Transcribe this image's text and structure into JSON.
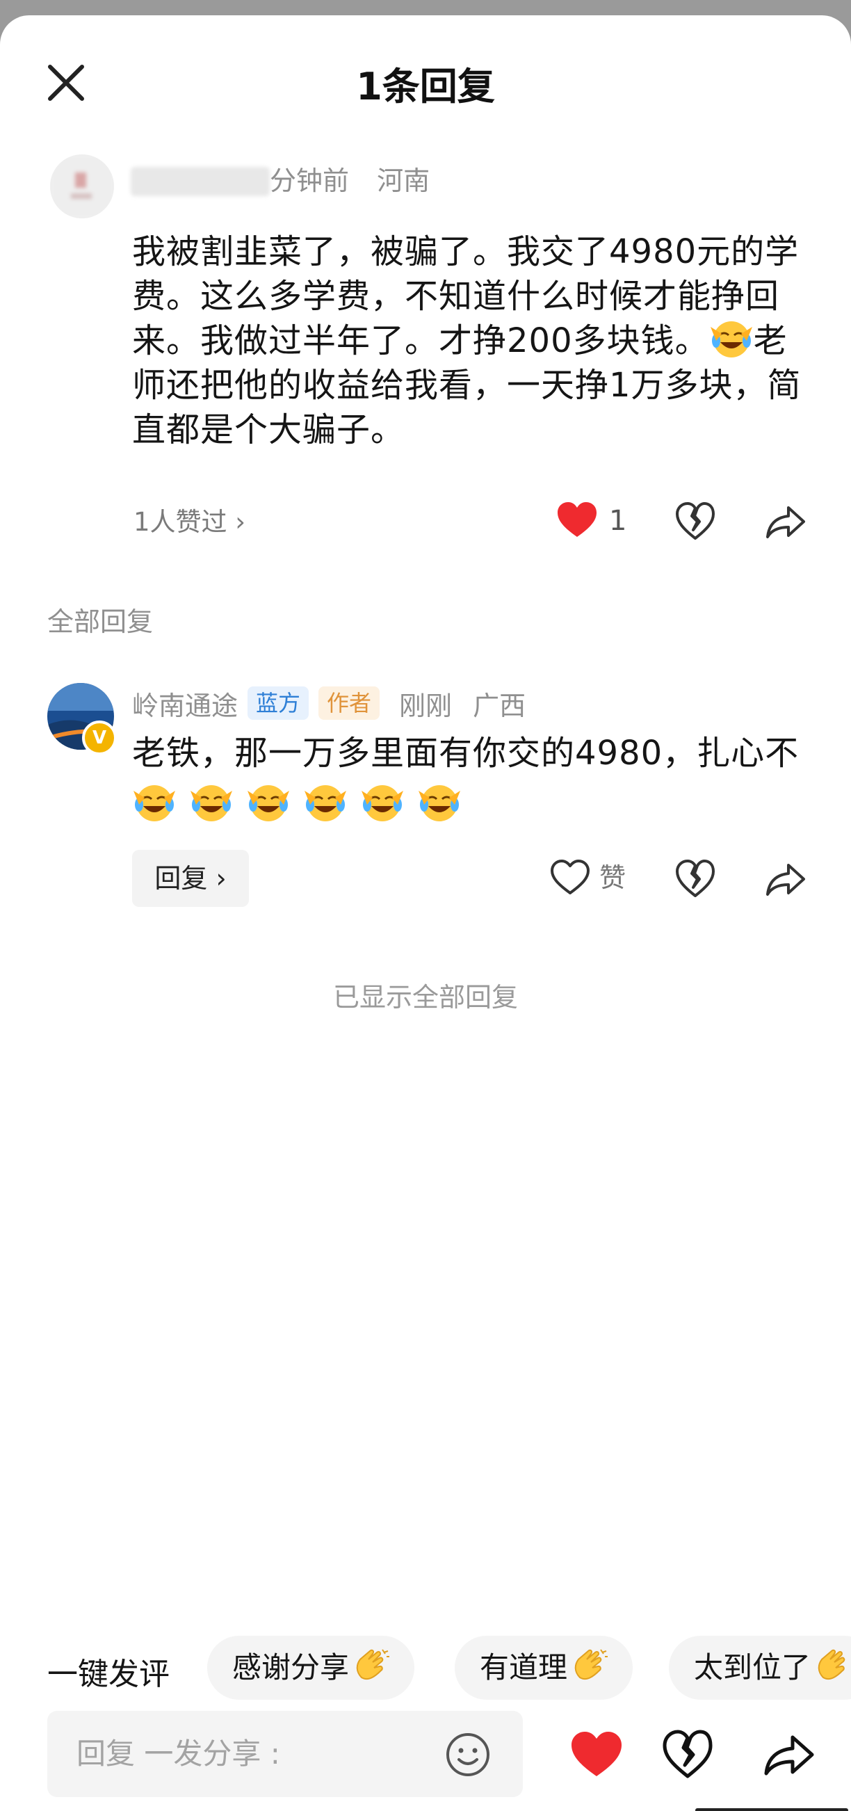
{
  "header": {
    "title": "1条回复"
  },
  "original_comment": {
    "time": "分钟前",
    "location": "河南",
    "text_parts": [
      "我被割韭菜了，被骗了。我交了4980元的学费。这么多学费，不知道什么时候才能挣回来。我做过半年了。才挣200多块钱。",
      "老师还把他的收益给我看，一天挣1万多块，简直都是个大骗子。"
    ],
    "likers": "1人赞过 ›",
    "like_count": "1",
    "liked": true
  },
  "section_label": "全部回复",
  "reply": {
    "author": "岭南通途",
    "badges": [
      "蓝方",
      "作者"
    ],
    "time": "刚刚",
    "location": "广西",
    "text": "老铁，那一万多里面有你交的4980，扎心不",
    "emoji_count": 6,
    "reply_button": "回复 ›",
    "like_label": "赞"
  },
  "all_shown": "已显示全部回复",
  "quick_comment": {
    "label": "一键发评",
    "chips": [
      "感谢分享",
      "有道理",
      "太到位了"
    ]
  },
  "input": {
    "placeholder": "回复 一发分享 :"
  },
  "colors": {
    "like_red": "#ef2a2f",
    "badge_blue": "#2e7fd6",
    "badge_orange": "#e0933a",
    "verified_gold": "#f4b400"
  }
}
